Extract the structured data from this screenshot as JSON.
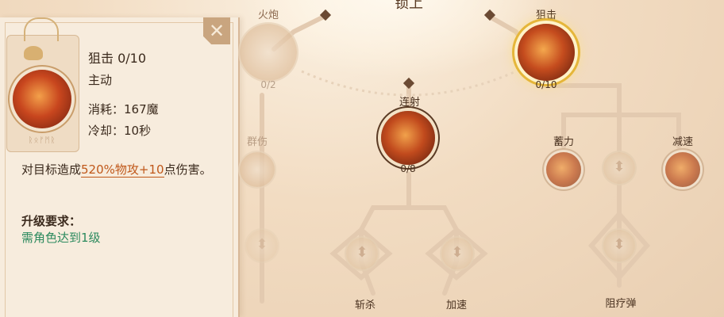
{
  "top_title": "锁上",
  "detail": {
    "title": "狙击 0/10",
    "type": "主动",
    "cost": "消耗：167魔",
    "cooldown": "冷却：10秒",
    "desc_prefix": "对目标造成",
    "desc_highlight": "520%物攻+10",
    "desc_suffix": "点伤害。",
    "requirement_label": "升级要求：",
    "requirement_value": "需角色达到1级",
    "card_rune": "ᚱᛟᚠᛗᚱ",
    "close_glyph": "✕"
  },
  "nodes": {
    "huopao": {
      "label": "火炮",
      "level": "0/2"
    },
    "juji": {
      "label": "狙击",
      "level": "0/10"
    },
    "lianshe": {
      "label": "连射",
      "level": "0/8"
    },
    "qunshang": {
      "label": "群伤"
    },
    "xuli": {
      "label": "蓄力"
    },
    "jiansu": {
      "label": "减速"
    },
    "zhansha": {
      "label": "斩杀"
    },
    "jiasu": {
      "label": "加速"
    },
    "zuliaodan": {
      "label": "阻疗弹"
    }
  },
  "colors": {
    "accent": "#c0581a",
    "requirement": "#2c8a5e",
    "gold_ring": "#e5b63a"
  },
  "icons": [
    "close-icon",
    "sniper-skill-icon",
    "cannon-skill-icon",
    "multishot-skill-icon",
    "lock-icon"
  ]
}
